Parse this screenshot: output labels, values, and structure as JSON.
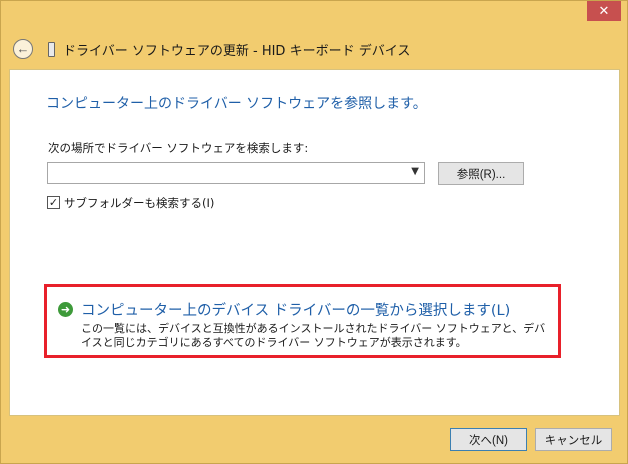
{
  "window": {
    "close_glyph": "✕",
    "back_icon": "back-arrow-icon"
  },
  "header": {
    "title": "ドライバー ソフトウェアの更新 - HID キーボード デバイス"
  },
  "main": {
    "heading": "コンピューター上のドライバー ソフトウェアを参照します。",
    "search_label": "次の場所でドライバー ソフトウェアを検索します:",
    "path_value": "",
    "browse_label": "参照(R)...",
    "include_subfolders": {
      "checked": true,
      "label": "サブフォルダーも検索する(I)"
    },
    "pick_option": {
      "title": "コンピューター上のデバイス ドライバーの一覧から選択します(L)",
      "description": "この一覧には、デバイスと互換性があるインストールされたドライバー ソフトウェアと、デバイスと同じカテゴリにあるすべてのドライバー ソフトウェアが表示されます。"
    }
  },
  "footer": {
    "next_label": "次へ(N)",
    "cancel_label": "キャンセル"
  },
  "colors": {
    "frame": "#f2cc6f",
    "heading_blue": "#1f5fa8",
    "highlight_red": "#e8202a",
    "close_red": "#c7504f"
  }
}
